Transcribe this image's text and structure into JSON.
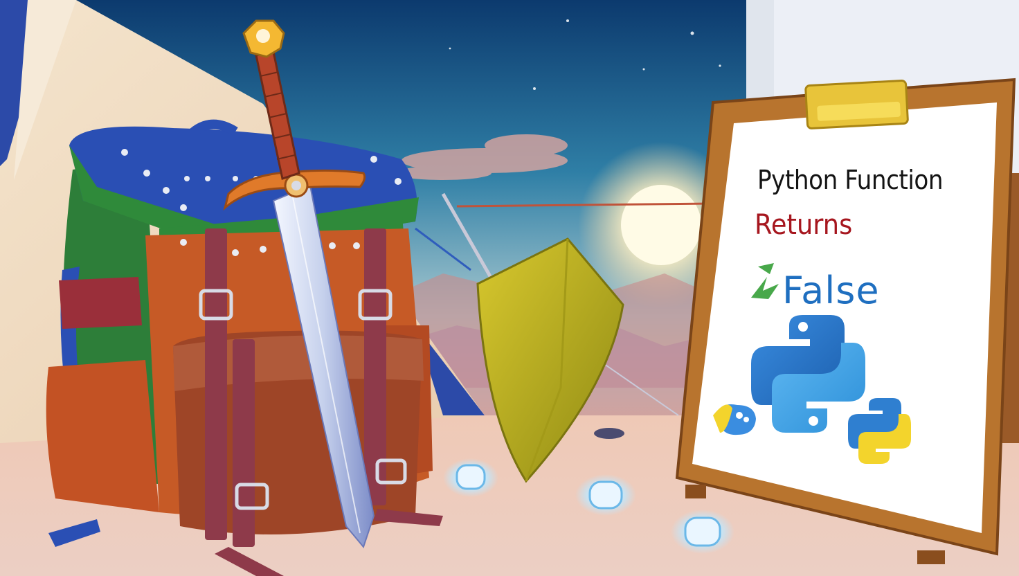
{
  "board": {
    "line1": "Python Function",
    "line2": "Returns",
    "line3": "False"
  },
  "colors": {
    "sky_top": "#0c3a6e",
    "sky_mid": "#3f8cb0",
    "sunset": "#f8c69a",
    "backpack_blue": "#2a4fb4",
    "backpack_green": "#2f8a3a",
    "leather": "#c65a26",
    "shield": "#c2b21c",
    "board_frame": "#b8742e",
    "python_blue": "#2f7fd0",
    "python_yellow": "#f3d42c",
    "text_red": "#a6161e"
  },
  "icons": [
    "sword-icon",
    "shield-icon",
    "backpack-icon",
    "python-logo-icon",
    "arrow-icon"
  ]
}
